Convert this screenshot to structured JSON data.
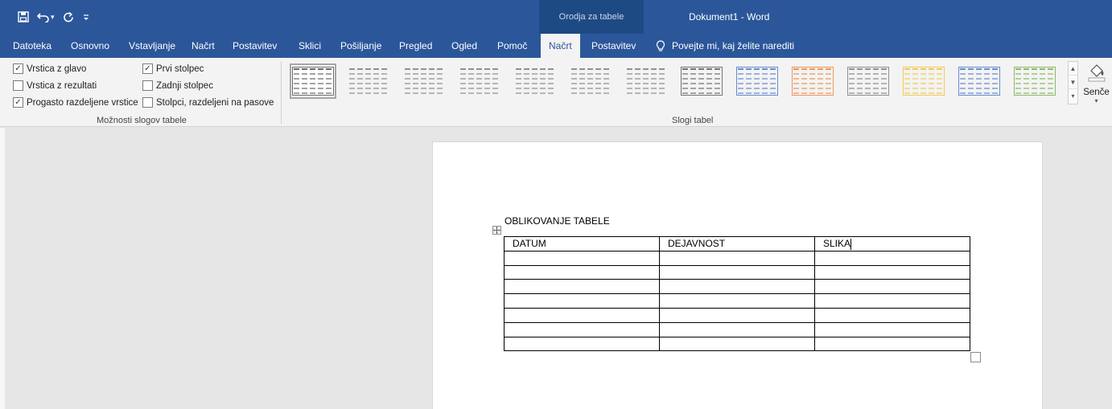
{
  "window": {
    "context_tools": "Orodja za tabele",
    "title": "Dokument1  -  Word"
  },
  "qat": {
    "icons": [
      "save-icon",
      "undo-icon",
      "redo-icon",
      "customize-icon"
    ]
  },
  "tabs": {
    "items": [
      "Datoteka",
      "Osnovno",
      "Vstavljanje",
      "Načrt",
      "Postavitev",
      "Sklici",
      "Pošiljanje",
      "Pregled",
      "Ogled",
      "Pomoč",
      "Načrt",
      "Postavitev"
    ],
    "active": "Načrt",
    "tell_me": "Povejte mi, kaj želite narediti"
  },
  "ribbon": {
    "table_style_options": {
      "label": "Možnosti slogov tabele",
      "options": [
        {
          "label": "Vrstica z glavo",
          "checked": true,
          "mark": "✓"
        },
        {
          "label": "Vrstica z rezultati",
          "checked": false,
          "mark": ""
        },
        {
          "label": "Progasto razdeljene vrstice",
          "checked": true,
          "mark": "✓"
        },
        {
          "label": "Prvi stolpec",
          "checked": true,
          "mark": "✓"
        },
        {
          "label": "Zadnji stolpec",
          "checked": false,
          "mark": ""
        },
        {
          "label": "Stolpci, razdeljeni na pasove",
          "checked": false,
          "mark": ""
        }
      ]
    },
    "table_styles": {
      "label": "Slogi tabel",
      "colors": [
        "#444444",
        "#777777",
        "#777777",
        "#777777",
        "#777777",
        "#777777",
        "#777777",
        "#555555",
        "#4472c4",
        "#ed7d31",
        "#777777",
        "#f2c12e",
        "#4472c4",
        "#70ad47"
      ]
    },
    "shading": {
      "label": "Senče"
    }
  },
  "document": {
    "heading": "OBLIKOVANJE TABELE",
    "table": {
      "header": [
        "DATUM",
        "DEJAVNOST",
        "SLIKA"
      ],
      "empty_rows": 7
    }
  }
}
